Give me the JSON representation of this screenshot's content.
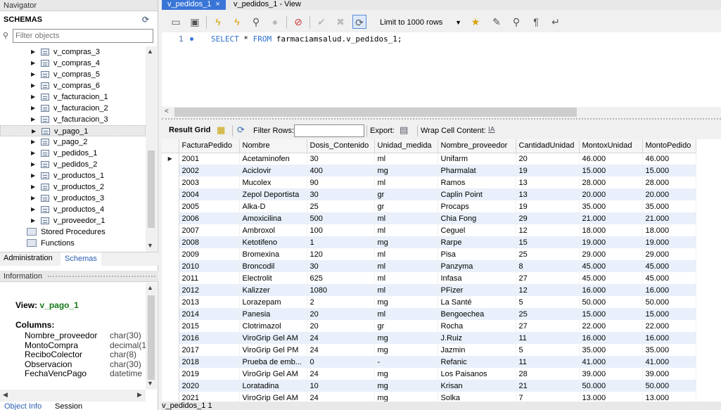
{
  "navigator": {
    "title": "Navigator",
    "schemas_label": "SCHEMAS",
    "filter_placeholder": "Filter objects",
    "tree_items": [
      "v_compras_3",
      "v_compras_4",
      "v_compras_5",
      "v_compras_6",
      "v_facturacion_1",
      "v_facturacion_2",
      "v_facturacion_3",
      "v_pago_1",
      "v_pago_2",
      "v_pedidos_1",
      "v_pedidos_2",
      "v_productos_1",
      "v_productos_2",
      "v_productos_3",
      "v_productos_4",
      "v_proveedor_1"
    ],
    "selected_item": "v_pago_1",
    "group_items": [
      "Stored Procedures",
      "Functions"
    ],
    "tabs": [
      "Administration",
      "Schemas"
    ],
    "active_tab": "Schemas"
  },
  "information": {
    "title": "Information",
    "view_label": "View:",
    "view_name": "v_pago_1",
    "columns_label": "Columns:",
    "columns": [
      {
        "name": "Nombre_proveedor",
        "type": "char(30)"
      },
      {
        "name": "MontoCompra",
        "type": "decimal(1"
      },
      {
        "name": "ReciboColector",
        "type": "char(8)"
      },
      {
        "name": "Observacion",
        "type": "char(30)"
      },
      {
        "name": "FechaVencPago",
        "type": "datetime"
      }
    ]
  },
  "bottom_tabs": [
    "Object Info",
    "Session"
  ],
  "editor_tabs": [
    {
      "label": "v_pedidos_1",
      "active": true
    },
    {
      "label": "v_pedidos_1 - View",
      "active": false
    }
  ],
  "toolbar": {
    "limit_label": "Limit to 1000 rows"
  },
  "editor": {
    "line_number": "1",
    "sql_keyword1": "SELECT",
    "sql_star": " * ",
    "sql_keyword2": "FROM",
    "sql_rest": " farmaciamsalud.v_pedidos_1;"
  },
  "result_toolbar": {
    "result_grid": "Result Grid",
    "filter_rows": "Filter Rows:",
    "export": "Export:",
    "wrap": "Wrap Cell Content:"
  },
  "grid": {
    "columns": [
      "FacturaPedido",
      "Nombre",
      "Dosis_Contenido",
      "Unidad_medida",
      "Nombre_proveedor",
      "CantidadUnidad",
      "MontoxUnidad",
      "MontoPedido"
    ],
    "rows": [
      [
        "2001",
        "Acetaminofen",
        "30",
        "ml",
        "Unifarm",
        "20",
        "46.000",
        "46.000"
      ],
      [
        "2002",
        "Aciclovir",
        "400",
        "mg",
        "Pharmalat",
        "19",
        "15.000",
        "15.000"
      ],
      [
        "2003",
        "Mucolex",
        "90",
        "ml",
        "Ramos",
        "13",
        "28.000",
        "28.000"
      ],
      [
        "2004",
        "Zepol Deportista",
        "30",
        "gr",
        "Caplin Point",
        "13",
        "20.000",
        "20.000"
      ],
      [
        "2005",
        "Alka-D",
        "25",
        "gr",
        "Procaps",
        "19",
        "35.000",
        "35.000"
      ],
      [
        "2006",
        "Amoxicilina",
        "500",
        "ml",
        "Chia Fong",
        "29",
        "21.000",
        "21.000"
      ],
      [
        "2007",
        "Ambroxol",
        "100",
        "ml",
        "Ceguel",
        "12",
        "18.000",
        "18.000"
      ],
      [
        "2008",
        "Ketotifeno",
        "1",
        "mg",
        "Rarpe",
        "15",
        "19.000",
        "19.000"
      ],
      [
        "2009",
        "Bromexina",
        "120",
        "ml",
        "Pisa",
        "25",
        "29.000",
        "29.000"
      ],
      [
        "2010",
        "Broncodil",
        "30",
        "ml",
        "Panzyma",
        "8",
        "45.000",
        "45.000"
      ],
      [
        "2011",
        "Electrolit",
        "625",
        "ml",
        "Infasa",
        "27",
        "45.000",
        "45.000"
      ],
      [
        "2012",
        "Kalizzer",
        "1080",
        "ml",
        "PFizer",
        "12",
        "16.000",
        "16.000"
      ],
      [
        "2013",
        "Lorazepam",
        "2",
        "mg",
        "La Santé",
        "5",
        "50.000",
        "50.000"
      ],
      [
        "2014",
        "Panesia",
        "20",
        "ml",
        "Bengoechea",
        "25",
        "15.000",
        "15.000"
      ],
      [
        "2015",
        "Clotrimazol",
        "20",
        "gr",
        "Rocha",
        "27",
        "22.000",
        "22.000"
      ],
      [
        "2016",
        "ViroGrip Gel AM",
        "24",
        "mg",
        "J.Ruiz",
        "11",
        "16.000",
        "16.000"
      ],
      [
        "2017",
        "ViroGrip Gel PM",
        "24",
        "mg",
        "Jazmin",
        "5",
        "35.000",
        "35.000"
      ],
      [
        "2018",
        "Prueba de emb...",
        "0",
        "-",
        "Refanic",
        "11",
        "41.000",
        "41.000"
      ],
      [
        "2019",
        "ViroGrip Gel AM",
        "24",
        "mg",
        "Los Paisanos",
        "28",
        "39.000",
        "39.000"
      ],
      [
        "2020",
        "Loratadina",
        "10",
        "mg",
        "Krisan",
        "21",
        "50.000",
        "50.000"
      ],
      [
        "2021",
        "ViroGrip Gel AM",
        "24",
        "mg",
        "Solka",
        "7",
        "13.000",
        "13.000"
      ]
    ]
  },
  "result_bottom_tab": "v_pedidos_1 1"
}
